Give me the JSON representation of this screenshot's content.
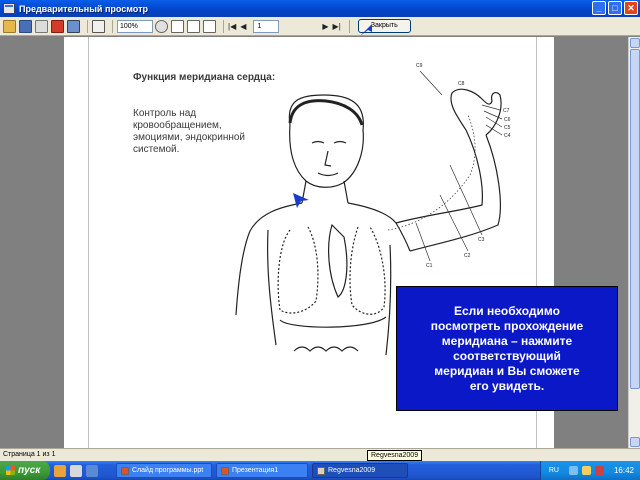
{
  "window": {
    "title": "Предварительный просмотр",
    "controls": {
      "minimize": "_",
      "maximize": "□",
      "close": "✕"
    }
  },
  "toolbar": {
    "zoom_value": "100%",
    "page_value": "1",
    "close_label": "Закрыть"
  },
  "document": {
    "heading": "Функция меридиана сердца:",
    "description": "Контроль над кровообращением, эмоциями, эндокринной системой.",
    "figure_labels": [
      "C9",
      "C8",
      "C7",
      "C6",
      "C5",
      "C4",
      "C3",
      "C2",
      "C1"
    ],
    "callout_text": "Если необходимо\nпосмотреть прохождение\nмеридиана – нажмите\nсоответствующий\nмеридиан и Вы сможете\nего увидеть."
  },
  "statusbar": {
    "page_info": "Страница 1 из 1",
    "tooltip": "Regvesna2009"
  },
  "taskbar": {
    "start_label": "пуск",
    "tasks": [
      "Слайд программы.ppt",
      "Презентация1",
      "Regvesna2009"
    ],
    "tray_lang": "RU",
    "clock": "16:42"
  },
  "colors": {
    "callout_bg": "#0a18c8",
    "pointer": "#1a3ccc",
    "titlebar": "#0a5ee8"
  }
}
